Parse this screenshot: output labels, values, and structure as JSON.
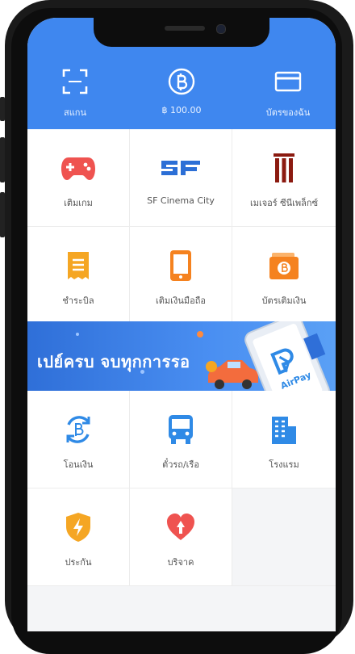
{
  "header": {
    "items": [
      {
        "icon": "scan-icon",
        "label": "สแกน"
      },
      {
        "icon": "baht-icon",
        "label": "฿ 100.00"
      },
      {
        "icon": "card-icon",
        "label": "บัตรของฉัน"
      }
    ]
  },
  "services_top": [
    {
      "icon": "game-controller-icon",
      "label": "เติมเกม",
      "color": "#ef5350"
    },
    {
      "icon": "sf-logo-icon",
      "label": "SF Cinema City",
      "color": "#2c6fd6"
    },
    {
      "icon": "major-cineplex-icon",
      "label": "เมเจอร์ ซีนีเพล็กซ์",
      "color": "#8b1a10"
    },
    {
      "icon": "bill-icon",
      "label": "ชำระบิล",
      "color": "#f5a623"
    },
    {
      "icon": "mobile-topup-icon",
      "label": "เติมเงินมือถือ",
      "color": "#f5821f"
    },
    {
      "icon": "wallet-topup-icon",
      "label": "บัตรเติมเงิน",
      "color": "#f5821f"
    }
  ],
  "banner": {
    "text": "เปย์ครบ จบทุกการรอ",
    "brand": "AirPay"
  },
  "services_bottom": [
    {
      "icon": "transfer-icon",
      "label": "โอนเงิน",
      "color": "#2f8ae6"
    },
    {
      "icon": "bus-icon",
      "label": "ตั๋วรถ/เรือ",
      "color": "#2f8ae6"
    },
    {
      "icon": "hotel-icon",
      "label": "โรงแรม",
      "color": "#2f8ae6"
    },
    {
      "icon": "insurance-icon",
      "label": "ประกัน",
      "color": "#f5a623"
    },
    {
      "icon": "donate-icon",
      "label": "บริจาค",
      "color": "#ef5350"
    }
  ],
  "colors": {
    "header": "#3f87ef",
    "accent": "#2f8ae6"
  }
}
